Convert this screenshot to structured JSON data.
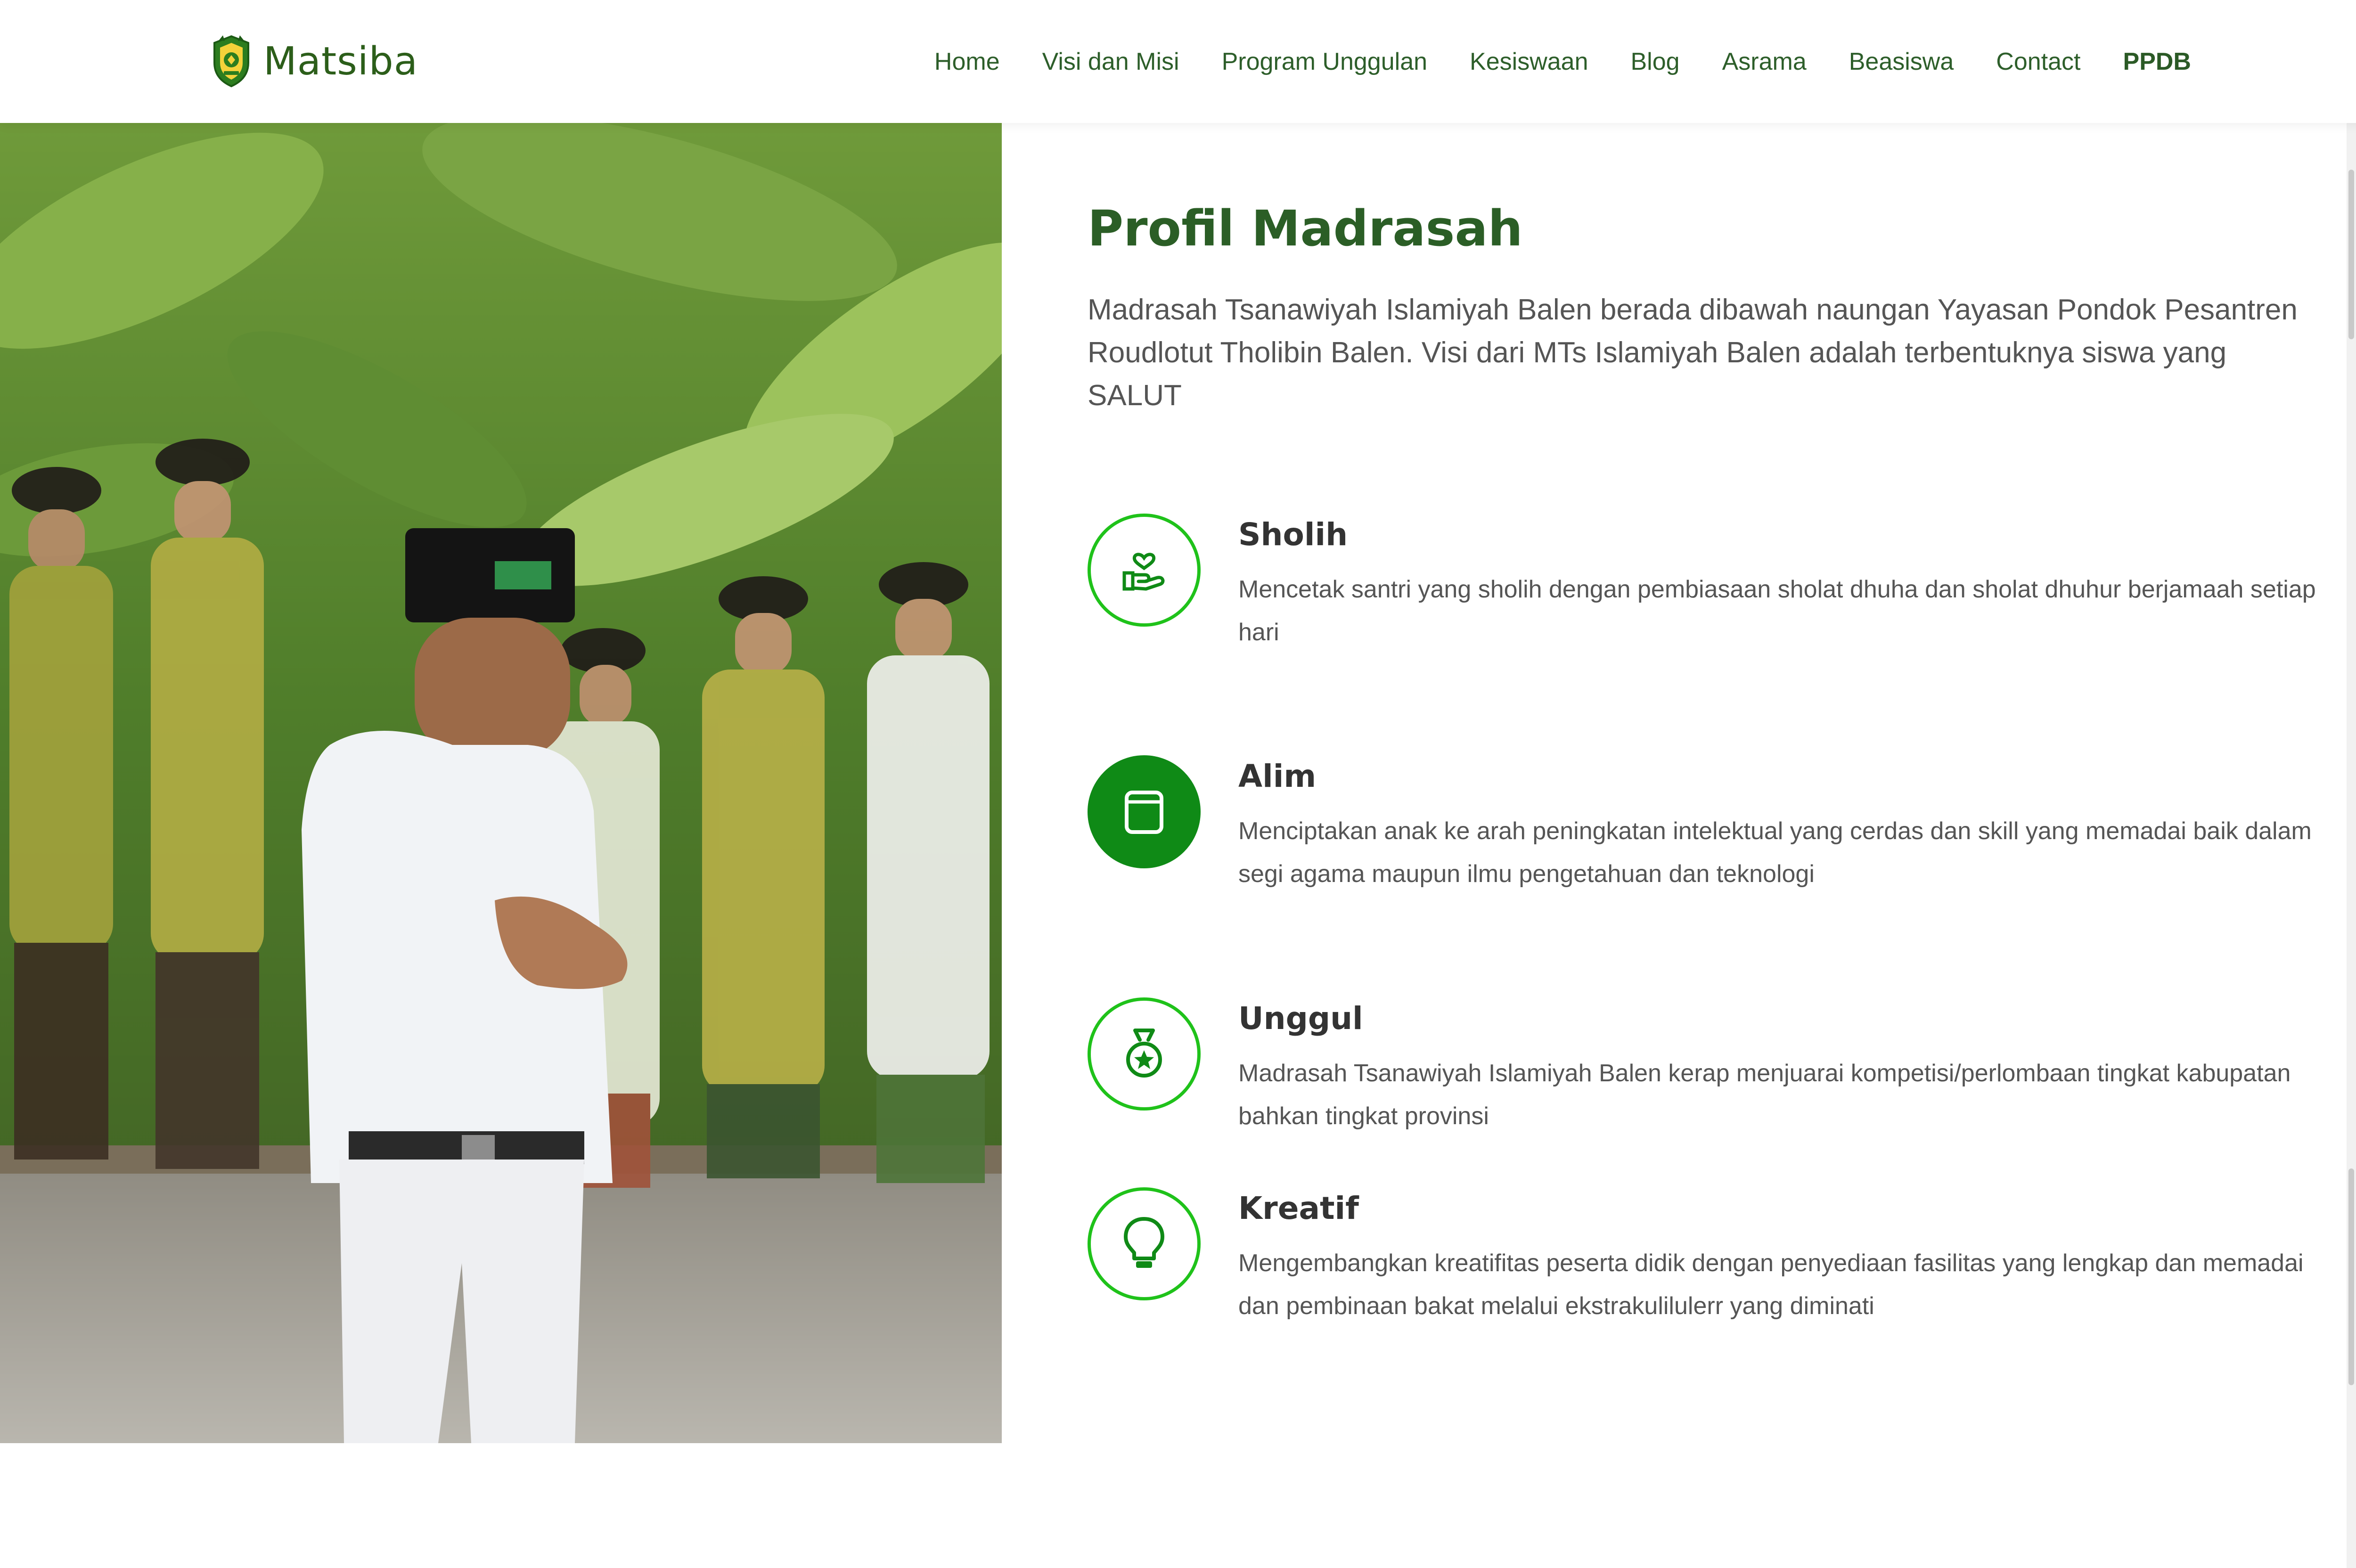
{
  "header": {
    "brand_name": "Matsiba",
    "nav": [
      {
        "label": "Home"
      },
      {
        "label": "Visi dan Misi"
      },
      {
        "label": "Program Unggulan"
      },
      {
        "label": "Kesiswaan"
      },
      {
        "label": "Blog"
      },
      {
        "label": "Asrama"
      },
      {
        "label": "Beasiswa"
      },
      {
        "label": "Contact"
      },
      {
        "label": "PPDB"
      }
    ]
  },
  "profile": {
    "title": "Profil Madrasah",
    "intro": "Madrasah Tsanawiyah Islamiyah Balen berada dibawah naungan Yayasan Pondok Pesantren Roudlotut Tholibin Balen. Visi dari MTs Islamiyah Balen adalah terbentuknya siswa yang SALUT",
    "features": [
      {
        "title": "Sholih",
        "text": "Mencetak santri yang sholih dengan pembiasaan sholat dhuha dan sholat dhuhur berjamaah setiap hari",
        "icon": "hand-heart-icon"
      },
      {
        "title": "Alim",
        "text": "Menciptakan anak ke arah peningkatan intelektual yang cerdas dan skill yang memadai baik dalam segi agama maupun ilmu pengetahuan dan teknologi",
        "icon": "book-icon"
      },
      {
        "title": "Unggul",
        "text": "Madrasah Tsanawiyah Islamiyah Balen kerap menjuarai kompetisi/perlombaan tingkat kabupatan bahkan tingkat provinsi",
        "icon": "medal-icon"
      },
      {
        "title": "Kreatif",
        "text": "Mengembangkan kreatifitas peserta didik dengan penyediaan fasilitas yang lengkap dan memadai dan pembinaan bakat melalui ekstrakulilulerr yang diminati",
        "icon": "lightbulb-icon"
      }
    ]
  },
  "colors": {
    "brand_green": "#2b5e26",
    "accent_green": "#1fc21a",
    "filled_green": "#0f8a16",
    "body_text": "#555555"
  }
}
